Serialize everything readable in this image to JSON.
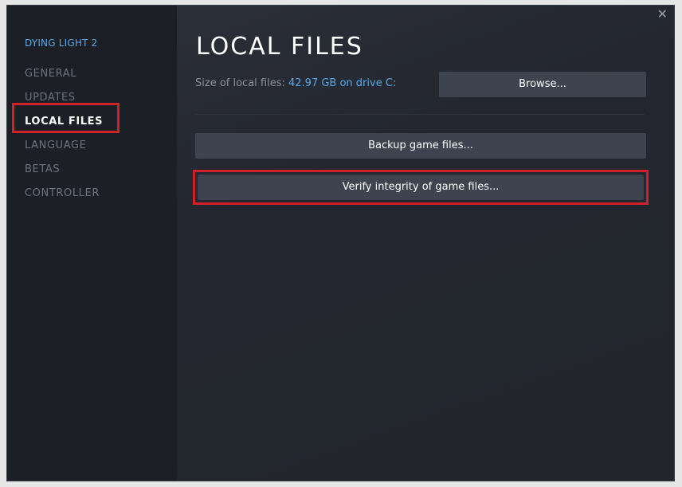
{
  "sidebar": {
    "game_title": "DYING LIGHT 2",
    "items": [
      {
        "label": "GENERAL"
      },
      {
        "label": "UPDATES"
      },
      {
        "label": "LOCAL FILES"
      },
      {
        "label": "LANGUAGE"
      },
      {
        "label": "BETAS"
      },
      {
        "label": "CONTROLLER"
      }
    ],
    "active_item": "LOCAL FILES"
  },
  "window": {
    "close_glyph": "✕"
  },
  "main": {
    "title": "LOCAL FILES",
    "size_label": "Size of local files:",
    "size_value": "42.97 GB on drive C:",
    "browse_label": "Browse...",
    "backup_label": "Backup game files...",
    "verify_label": "Verify integrity of game files..."
  },
  "colors": {
    "accent_link": "#5aa9e6",
    "highlight": "#d0212a",
    "button_bg": "#3d4450"
  },
  "icons": {
    "close": "close-icon"
  }
}
